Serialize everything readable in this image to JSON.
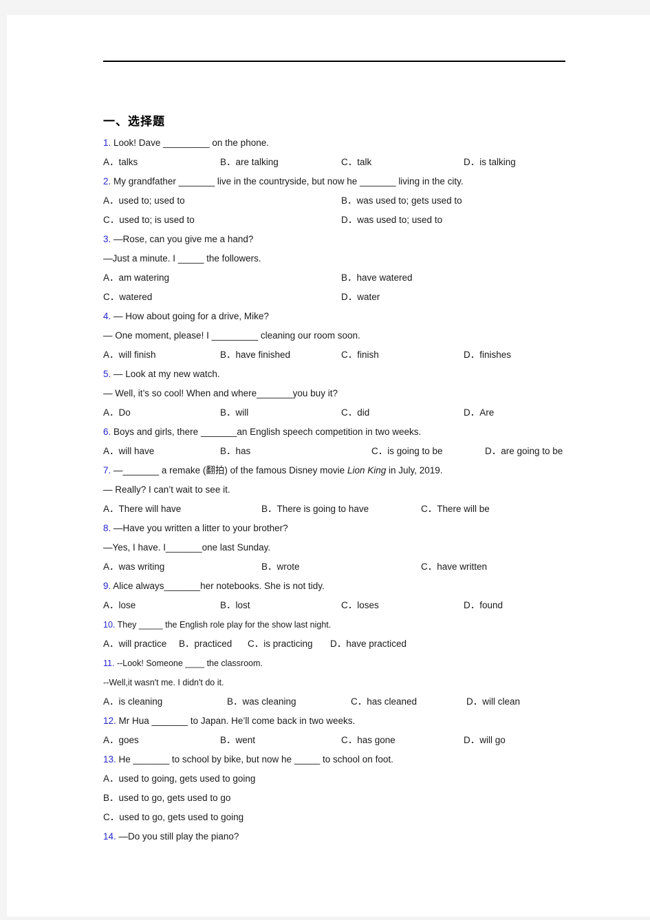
{
  "document": {
    "section_heading": "一、选择题",
    "questions": [
      {
        "num": "1.",
        "stem": "Look! Dave _________ on the phone.",
        "layout": "cols4",
        "options": [
          "A．talks",
          "B．are talking",
          "C．talk",
          "D．is talking"
        ]
      },
      {
        "num": "2.",
        "stem": "My grandfather _______ live in the countryside, but now he _______ living in the city.",
        "layout": "cols2",
        "options": [
          "A．used to; used to",
          "B．was used to; gets used to",
          "C．used to; is used to",
          "D．was used to; used to"
        ]
      },
      {
        "num": "3.",
        "stem": "—Rose, can you give me a hand?",
        "stem2": "—Just a minute. I _____ the followers.",
        "layout": "cols2",
        "options": [
          "A．am watering",
          "B．have watered",
          "C．watered",
          "D．water"
        ]
      },
      {
        "num": "4.",
        "stem": "— How about going for a drive, Mike?",
        "stem2": "— One moment, please! I _________ cleaning our room soon.",
        "layout": "cols4",
        "options": [
          "A．will finish",
          "B．have finished",
          "C．finish",
          "D．finishes"
        ]
      },
      {
        "num": "5.",
        "stem": "— Look at my new watch.",
        "stem2": "— Well, it’s so cool! When and where_______you buy it?",
        "layout": "cols4",
        "options": [
          "A．Do",
          "B．will",
          "C．did",
          "D．Are"
        ]
      },
      {
        "num": "6.",
        "stem": "Boys and girls, there _______an English speech competition in two weeks.",
        "layout": "cols4b",
        "options": [
          "A．will have",
          "B．has",
          "C．is going to be",
          "D．are going to be"
        ]
      },
      {
        "num": "7.",
        "stem_parts": [
          "—_______ a remake (翻拍) of the famous Disney movie ",
          "Lion King",
          " in July, 2019."
        ],
        "stem2": "— Really? I can’t wait to see it.",
        "layout": "cols3",
        "options": [
          "A．There will have",
          "B．There is going to have",
          "C．There will be"
        ]
      },
      {
        "num": "8.",
        "stem": "—Have you written a litter to your brother?",
        "stem2": "—Yes, I have. I_______one last Sunday.",
        "layout": "cols3",
        "options": [
          "A．was writing",
          "B．wrote",
          "C．have written"
        ]
      },
      {
        "num": "9.",
        "stem": "Alice always_______her notebooks. She is not tidy.",
        "layout": "cols4",
        "options": [
          "A．lose",
          "B．lost",
          "C．loses",
          "D．found"
        ]
      },
      {
        "num": "10.",
        "stem": "They _____    the English role play for the show last night.",
        "narrow": true,
        "layout": "cols4t",
        "options": [
          "A．will practice",
          "B．practiced",
          "C．is practicing",
          "D．have practiced"
        ]
      },
      {
        "num": "11.",
        "stem": "--Look! Someone ____ the classroom.",
        "stem2": "--Well,it wasn't me. I didn't do it.",
        "narrow": true,
        "layout": "cols4c",
        "options": [
          "A．is cleaning",
          "B．was cleaning",
          "C．has cleaned",
          "D．will clean"
        ]
      },
      {
        "num": "12.",
        "stem": "Mr Hua _______ to Japan. He’ll come back in two weeks.",
        "layout": "cols4",
        "options": [
          "A．goes",
          "B．went",
          "C．has gone",
          "D．will go"
        ]
      },
      {
        "num": "13.",
        "stem": "He _______ to school by bike, but now he _____ to school on foot.",
        "layout": "stack",
        "options": [
          "A．used to going, gets used to going",
          "B．used to go, gets used to go",
          "C．used to go, gets used to going"
        ]
      },
      {
        "num": "14.",
        "stem": "—Do you still play the piano?",
        "layout": "none",
        "options": []
      }
    ]
  },
  "colors": {
    "question_number": "#2727d0",
    "body_text": "#1a1a1a",
    "page_background": "#ffffff",
    "canvas_background": "#f4f4f4",
    "rule": "#000000"
  }
}
